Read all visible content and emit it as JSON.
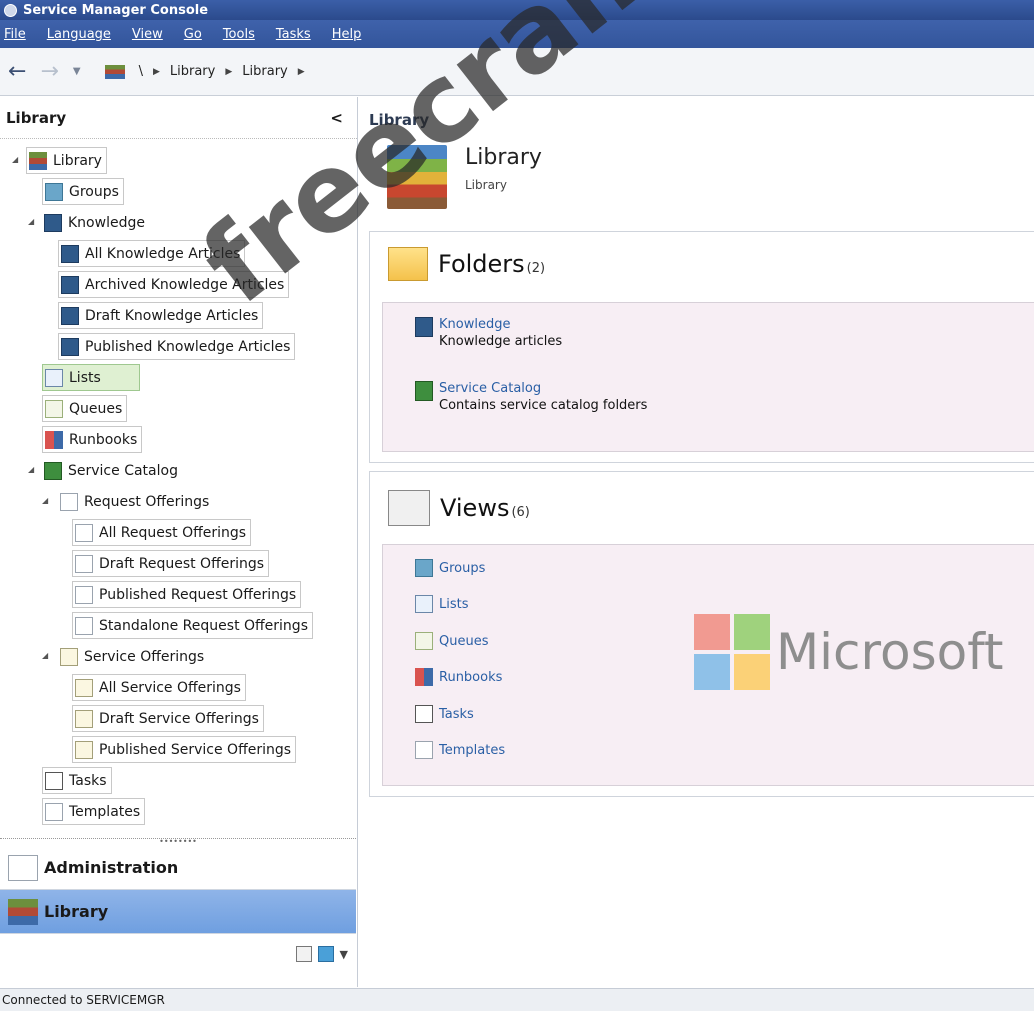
{
  "window": {
    "title": "Service Manager Console"
  },
  "menu": [
    "File",
    "Language",
    "View",
    "Go",
    "Tools",
    "Tasks",
    "Help"
  ],
  "breadcrumb": {
    "items": [
      "\\",
      "Library",
      "Library"
    ]
  },
  "left_pane": {
    "title": "Library",
    "collapse_glyph": "<",
    "tree": [
      {
        "label": "Library",
        "icon": "library-icon"
      },
      {
        "label": "Groups",
        "icon": "groups-icon"
      },
      {
        "label": "Knowledge",
        "icon": "knowledge-icon"
      },
      {
        "label": "All Knowledge Articles",
        "icon": "knowledge-icon"
      },
      {
        "label": "Archived Knowledge Articles",
        "icon": "knowledge-icon"
      },
      {
        "label": "Draft Knowledge Articles",
        "icon": "knowledge-icon"
      },
      {
        "label": "Published Knowledge Articles",
        "icon": "knowledge-icon"
      },
      {
        "label": "Lists",
        "icon": "lists-icon"
      },
      {
        "label": "Queues",
        "icon": "queues-icon"
      },
      {
        "label": "Runbooks",
        "icon": "runbooks-icon"
      },
      {
        "label": "Service Catalog",
        "icon": "service-catalog-icon"
      },
      {
        "label": "Request Offerings",
        "icon": "document-icon"
      },
      {
        "label": "All Request Offerings",
        "icon": "document-icon"
      },
      {
        "label": "Draft Request Offerings",
        "icon": "document-icon"
      },
      {
        "label": "Published Request Offerings",
        "icon": "document-icon"
      },
      {
        "label": "Standalone Request Offerings",
        "icon": "document-icon"
      },
      {
        "label": "Service Offerings",
        "icon": "service-offering-icon"
      },
      {
        "label": "All Service Offerings",
        "icon": "service-offering-icon"
      },
      {
        "label": "Draft Service Offerings",
        "icon": "service-offering-icon"
      },
      {
        "label": "Published Service Offerings",
        "icon": "service-offering-icon"
      },
      {
        "label": "Tasks",
        "icon": "tasks-icon"
      },
      {
        "label": "Templates",
        "icon": "templates-icon"
      }
    ],
    "wunderbar": [
      {
        "label": "Administration",
        "icon": "administration-icon"
      },
      {
        "label": "Library",
        "icon": "library-icon"
      }
    ]
  },
  "main": {
    "header": "Library",
    "library": {
      "title": "Library",
      "subtitle": "Library"
    },
    "folders": {
      "title": "Folders",
      "count": "(2)",
      "items": [
        {
          "name": "Knowledge",
          "description": "Knowledge articles",
          "icon": "knowledge-icon"
        },
        {
          "name": "Service Catalog",
          "description": "Contains service catalog folders",
          "icon": "service-catalog-icon"
        }
      ]
    },
    "views": {
      "title": "Views",
      "count": "(6)",
      "items": [
        {
          "name": "Groups",
          "icon": "groups-icon"
        },
        {
          "name": "Lists",
          "icon": "lists-icon"
        },
        {
          "name": "Queues",
          "icon": "queues-icon"
        },
        {
          "name": "Runbooks",
          "icon": "runbooks-icon"
        },
        {
          "name": "Tasks",
          "icon": "tasks-icon"
        },
        {
          "name": "Templates",
          "icon": "templates-icon"
        }
      ]
    }
  },
  "watermark": "freecram.net",
  "logo": {
    "text": "Microsoft"
  },
  "status_bar": {
    "text": "Connected to SERVICEMGR"
  }
}
